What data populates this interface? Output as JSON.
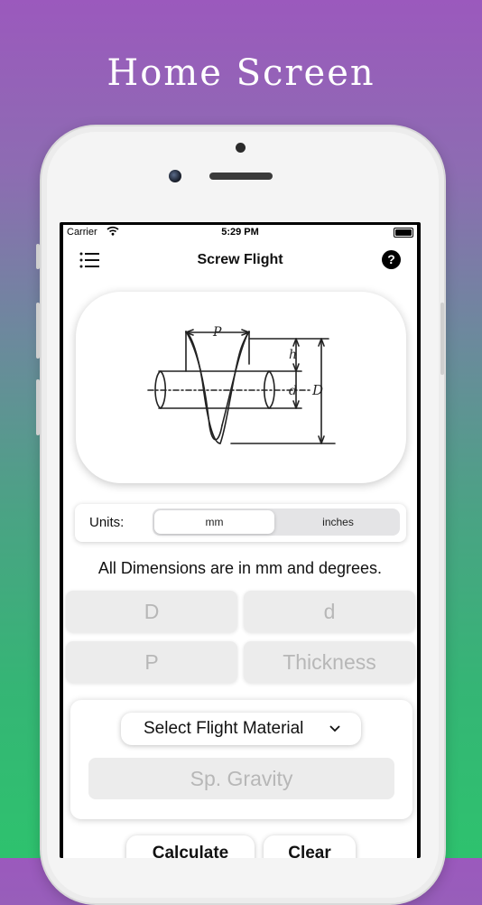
{
  "hero": {
    "title": "Home Screen"
  },
  "status_bar": {
    "carrier": "Carrier",
    "time": "5:29 PM"
  },
  "navbar": {
    "title": "Screw Flight",
    "help_label": "?"
  },
  "diagram": {
    "label_p": "P",
    "label_h": "h",
    "label_d": "d",
    "label_D": "D"
  },
  "units": {
    "label": "Units:",
    "options": [
      "mm",
      "inches"
    ],
    "selected": "mm"
  },
  "dimensions_note": "All Dimensions are in mm and degrees.",
  "fields": {
    "D_placeholder": "D",
    "d_placeholder": "d",
    "P_placeholder": "P",
    "thickness_placeholder": "Thickness"
  },
  "material": {
    "select_label": "Select Flight Material",
    "gravity_placeholder": "Sp. Gravity"
  },
  "actions": {
    "calculate_label": "Calculate",
    "clear_label": "Clear"
  }
}
